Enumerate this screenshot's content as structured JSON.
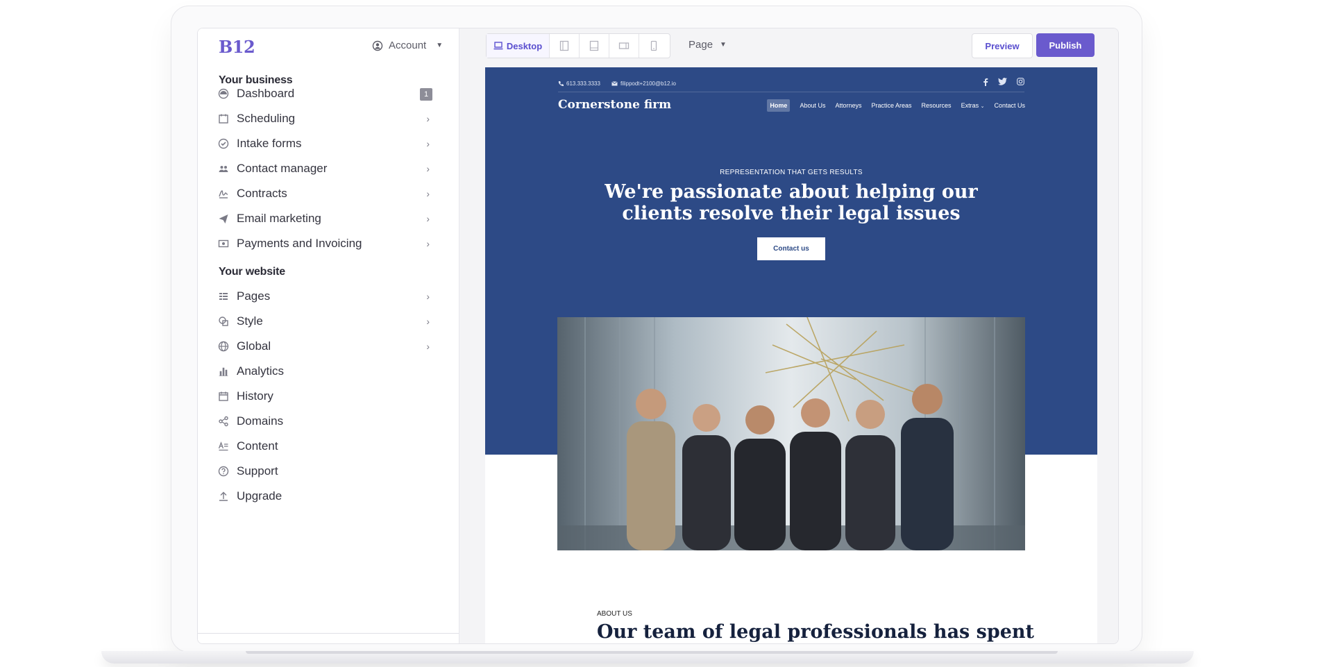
{
  "app": {
    "logo": "B12",
    "account_label": "Account"
  },
  "sidebar": {
    "business_title": "Your business",
    "business_items": [
      {
        "label": "Dashboard",
        "icon": "dashboard-icon",
        "badge": "1"
      },
      {
        "label": "Scheduling",
        "icon": "calendar-icon"
      },
      {
        "label": "Intake forms",
        "icon": "check-circle-icon"
      },
      {
        "label": "Contact manager",
        "icon": "people-icon"
      },
      {
        "label": "Contracts",
        "icon": "signature-icon"
      },
      {
        "label": "Email marketing",
        "icon": "paper-plane-icon"
      },
      {
        "label": "Payments and Invoicing",
        "icon": "money-icon"
      }
    ],
    "website_title": "Your website",
    "website_items": [
      {
        "label": "Pages",
        "icon": "pages-icon"
      },
      {
        "label": "Style",
        "icon": "palette-icon"
      },
      {
        "label": "Global",
        "icon": "globe-icon"
      },
      {
        "label": "Analytics",
        "icon": "bar-chart-icon"
      },
      {
        "label": "History",
        "icon": "history-calendar-icon"
      },
      {
        "label": "Domains",
        "icon": "share-icon"
      },
      {
        "label": "Content",
        "icon": "content-icon"
      },
      {
        "label": "Support",
        "icon": "help-icon"
      },
      {
        "label": "Upgrade",
        "icon": "upload-icon"
      }
    ]
  },
  "toolbar": {
    "device_label": "Desktop",
    "page_label": "Page",
    "preview_label": "Preview",
    "publish_label": "Publish",
    "accent": "#6a5acd"
  },
  "site": {
    "phone": "613.333.3333",
    "email": "filippodt+2100@b12.io",
    "brand": "Cornerstone firm",
    "nav": [
      "Home",
      "About Us",
      "Attorneys",
      "Practice Areas",
      "Resources",
      "Extras",
      "Contact Us"
    ],
    "eyebrow": "REPRESENTATION THAT GETS RESULTS",
    "headline": "We're passionate about helping our clients resolve their legal issues",
    "cta": "Contact us",
    "about_label": "ABOUT US",
    "about_title": "Our team of legal professionals has spent",
    "hero_color": "#2d4a86"
  }
}
